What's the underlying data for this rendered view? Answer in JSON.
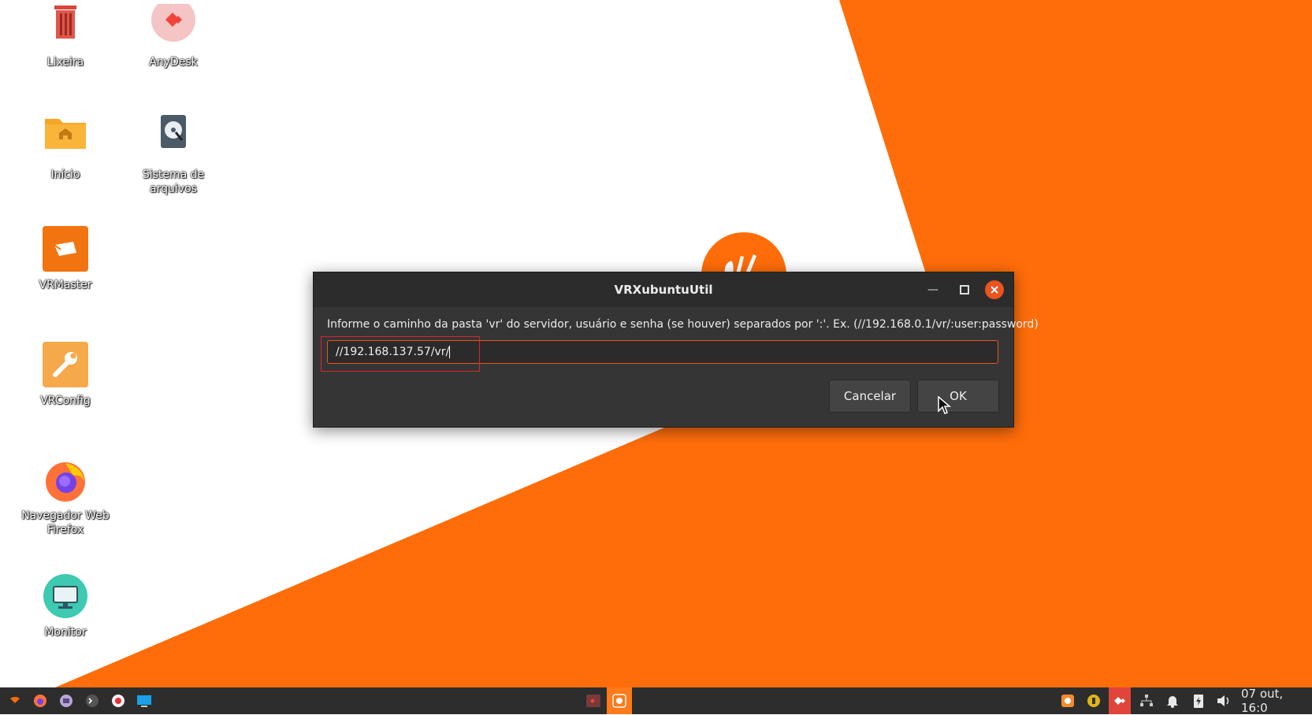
{
  "desktop": {
    "icons": [
      {
        "label": "Lixeira"
      },
      {
        "label": "AnyDesk"
      },
      {
        "label": "Início"
      },
      {
        "label": "Sistema de arquivos"
      },
      {
        "label": "VRMaster"
      },
      {
        "label": "VRConfig"
      },
      {
        "label": "Navegador Web Firefox"
      },
      {
        "label": "Monitor"
      }
    ]
  },
  "dialog": {
    "title": "VRXubuntuUtil",
    "prompt": "Informe o caminho da pasta 'vr' do servidor, usuário e senha (se houver) separados por ':'. Ex. (//192.168.0.1/vr/:user:password)",
    "input_value": "//192.168.137.57/vr/",
    "cancel_label": "Cancelar",
    "ok_label": "OK"
  },
  "taskbar": {
    "clock": "07 out, 16:0"
  },
  "colors": {
    "accent": "#e95420",
    "wallpaper_orange": "#ff6d0a",
    "taskbar": "#2d2d2d"
  }
}
